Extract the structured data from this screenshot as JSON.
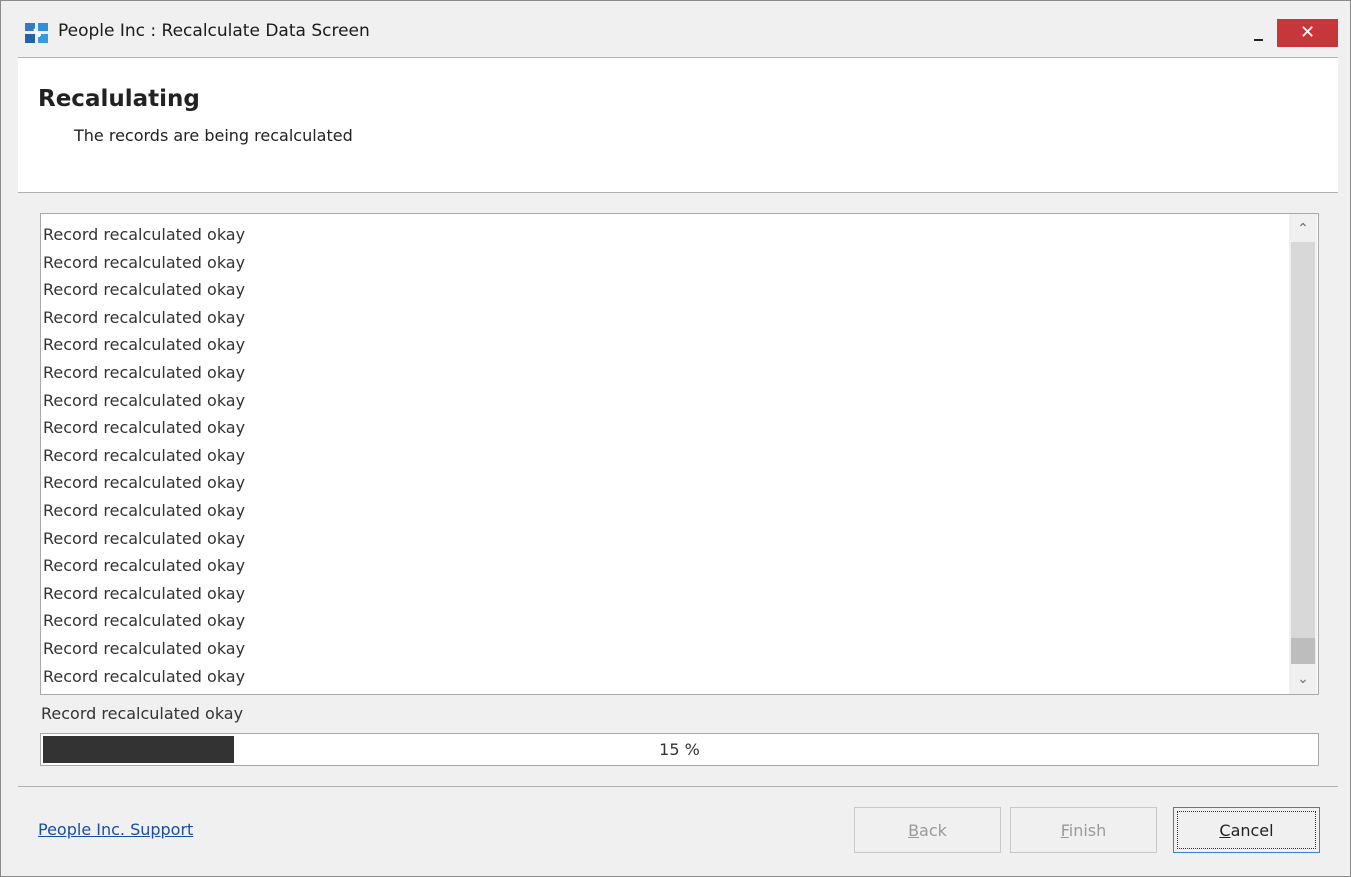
{
  "window": {
    "title": "People Inc : Recalculate Data Screen",
    "close_glyph": "✕",
    "colors": {
      "close_bg": "#c7363b",
      "progress_fill": "#333333",
      "link": "#1a4fa0"
    }
  },
  "header": {
    "title": "Recalulating",
    "subtitle": "The records are being recalculated"
  },
  "log": {
    "items": [
      "Record recalculated okay",
      "Record recalculated okay",
      "Record recalculated okay",
      "Record recalculated okay",
      "Record recalculated okay",
      "Record recalculated okay",
      "Record recalculated okay",
      "Record recalculated okay",
      "Record recalculated okay",
      "Record recalculated okay",
      "Record recalculated okay",
      "Record recalculated okay",
      "Record recalculated okay",
      "Record recalculated okay",
      "Record recalculated okay",
      "Record recalculated okay",
      "Record recalculated okay"
    ],
    "scroll_up_glyph": "⌃",
    "scroll_down_glyph": "⌄"
  },
  "status_text": "Record recalculated okay",
  "progress": {
    "percent": 15,
    "label": "15 %"
  },
  "footer": {
    "support_link": "People Inc. Support",
    "back": {
      "accel": "B",
      "rest": "ack"
    },
    "finish": {
      "accel": "F",
      "rest": "inish"
    },
    "cancel": {
      "accel": "C",
      "rest": "ancel"
    }
  }
}
